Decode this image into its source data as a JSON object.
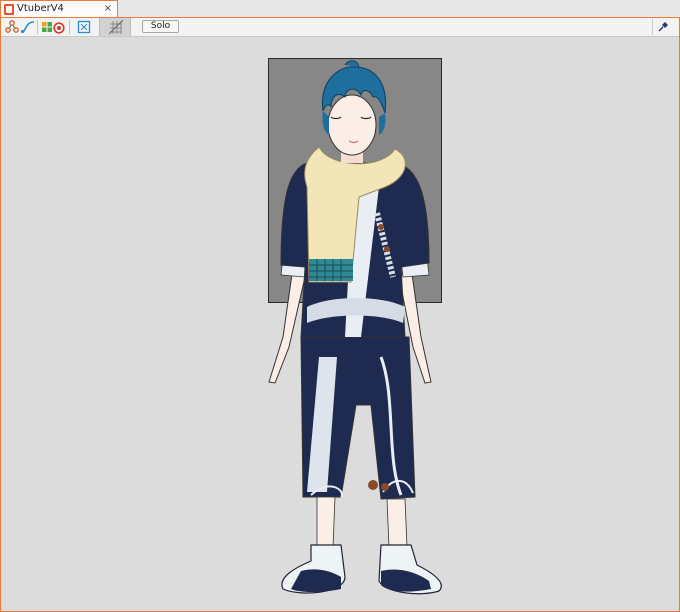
{
  "window": {
    "tab_title": "VtuberV4",
    "close_symbol": "×"
  },
  "toolbar": {
    "solo_label": "Solo"
  },
  "colors": {
    "accent": "#e87a3c",
    "canvas_bg": "#dcdcdc",
    "camera_frame": "#878787",
    "hair": "#1f6f9e",
    "scarf": "#f2e6b8",
    "outfit_navy": "#1e2a4f",
    "pattern_teal": "#2e8b95"
  },
  "icons": [
    "connect-nodes-icon",
    "link-curve-icon",
    "group-icon",
    "record-icon",
    "frame-fit-icon",
    "grid-toggle-icon",
    "pin-icon"
  ]
}
